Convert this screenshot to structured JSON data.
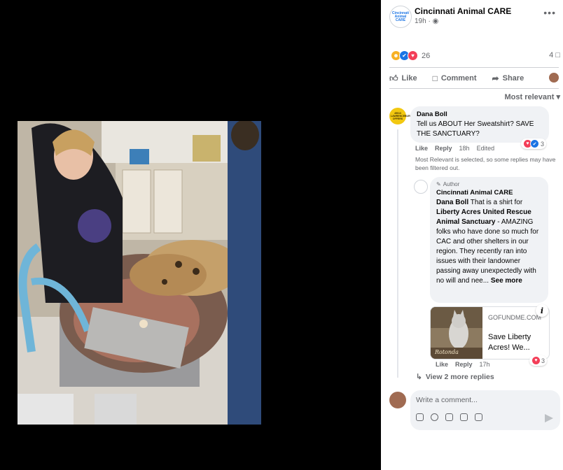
{
  "post": {
    "page_name": "Cincinnati Animal CARE",
    "time": "19h · ",
    "globe_icon": "globe-icon",
    "avatar_text": "Cincinnati Animal CARE",
    "reactions": {
      "icons": [
        "haha-icon",
        "like-icon",
        "love-icon"
      ],
      "count": "26"
    },
    "comment_count": "4"
  },
  "actions": {
    "like": "Like",
    "comment": "Comment",
    "share": "Share"
  },
  "sort_label": "Most relevant",
  "comments": [
    {
      "author": "Dana Boll",
      "avatar_text": "45013 LAWRENCEBURG OFFERS",
      "text": "Tell us ABOUT Her Sweatshirt? SAVE THE SANCTUARY?",
      "like": "Like",
      "reply": "Reply",
      "time": "18h",
      "edited": "Edited",
      "reaction_count": "3"
    }
  ],
  "filter_note": "Most Relevant is selected, so some replies may have been filtered out.",
  "reply": {
    "badge": "Author",
    "author": "Cincinnati Animal CARE",
    "mention": "Dana Boll",
    "text_before": " That is a shirt for ",
    "bold_org": "Liberty Acres United Rescue Animal Sanctuary",
    "text_after": " - AMAZING folks who have done so much for CAC and other shelters in our region. They recently ran into issues with their landowner passing away unexpectedly with no will and nee...",
    "see_more": " See more",
    "link": {
      "domain": "GOFUNDME.COM",
      "title": "Save Liberty Acres! We...",
      "thumb_caption": "Rotonda"
    },
    "like": "Like",
    "reply": "Reply",
    "time": "17h",
    "reaction_count": "3"
  },
  "view_more": "View 2 more replies",
  "composer": {
    "placeholder": "Write a comment..."
  },
  "colors": {
    "link_blue": "#1b74e4",
    "meta_gray": "#65676b",
    "bubble": "#f0f2f5",
    "love": "#f33e58"
  }
}
